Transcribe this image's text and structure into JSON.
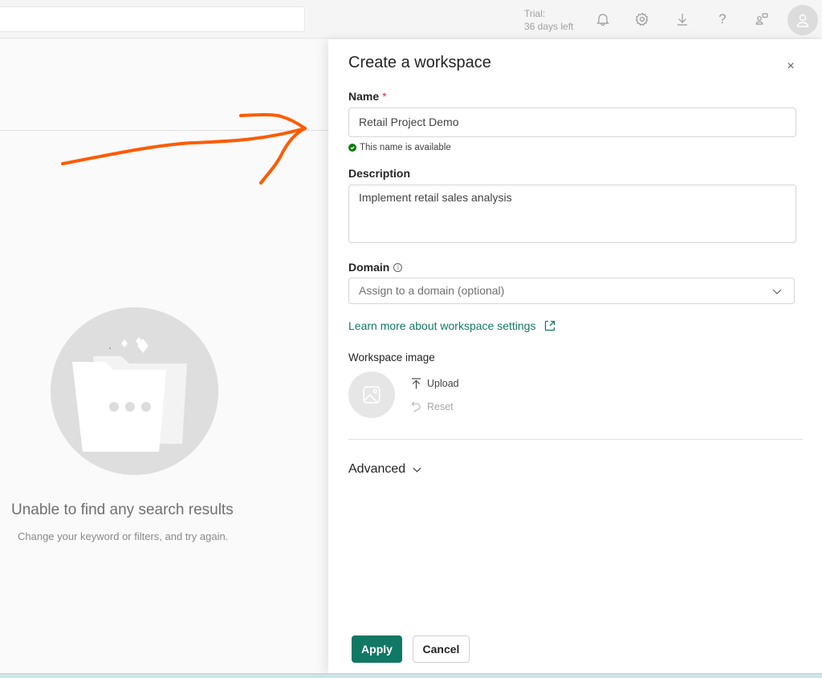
{
  "topbar": {
    "trial_label": "Trial:",
    "trial_days": "36 days left",
    "icons": [
      "bell-icon",
      "gear-icon",
      "download-icon",
      "help-icon",
      "feedback-icon",
      "avatar-icon"
    ]
  },
  "background": {
    "empty_title": "Unable to find any search results",
    "empty_subtitle": "Change your keyword or filters, and try again.",
    "annotation_color": "#ff5a00"
  },
  "panel": {
    "title": "Create a workspace",
    "close_label": "×",
    "name": {
      "label": "Name",
      "required_mark": "*",
      "value": "Retail Project Demo",
      "validation": "This name is available"
    },
    "description": {
      "label": "Description",
      "value": "Implement retail sales analysis"
    },
    "domain": {
      "label": "Domain",
      "info": "i",
      "placeholder": "Assign to a domain (optional)"
    },
    "learn_more": "Learn more about workspace settings",
    "workspace_image": {
      "label": "Workspace image",
      "upload": "Upload",
      "reset": "Reset"
    },
    "advanced": "Advanced",
    "buttons": {
      "apply": "Apply",
      "cancel": "Cancel"
    }
  },
  "colors": {
    "accent": "#117865",
    "success": "#107c10",
    "required": "#c4314b"
  }
}
